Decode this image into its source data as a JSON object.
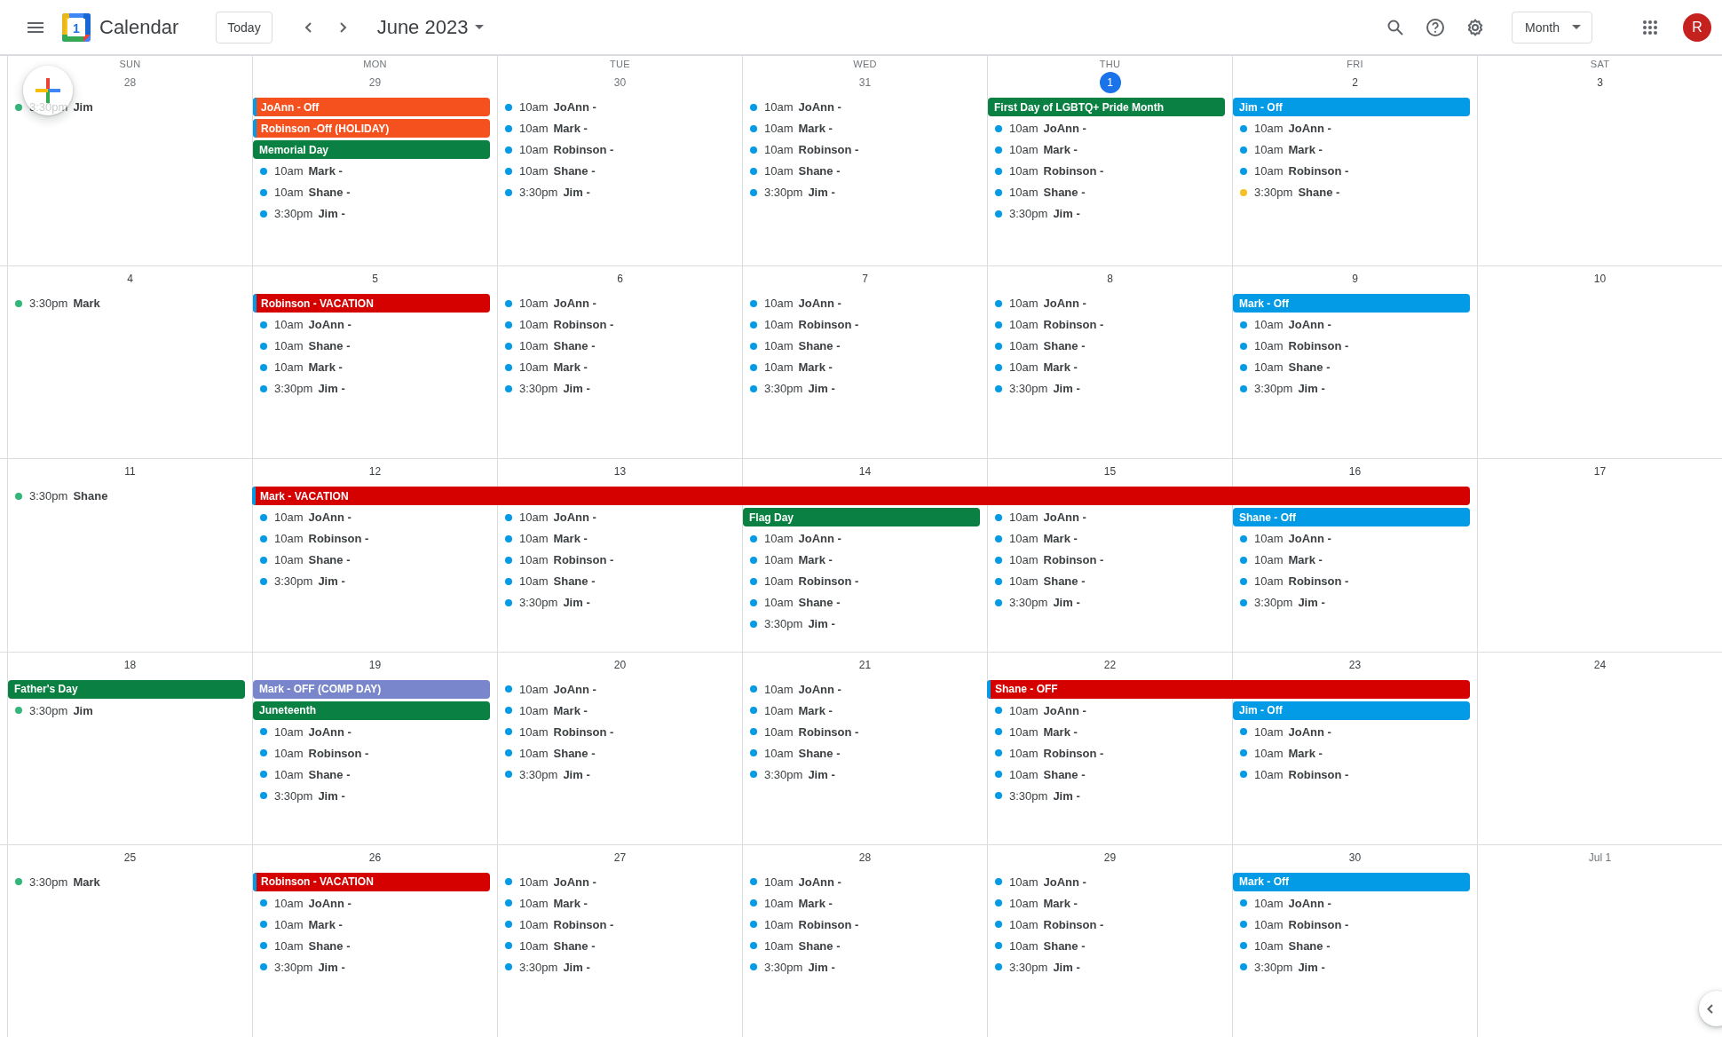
{
  "header": {
    "logo_day": "1",
    "app_name": "Calendar",
    "today_button": "Today",
    "period": "June 2023",
    "view_menu": "Month",
    "avatar_letter": "R"
  },
  "weeks": [
    {
      "days": [
        {
          "weekday": "SUN",
          "date": "28",
          "in_month": false,
          "today": false,
          "events": [
            {
              "kind": "timed",
              "time": "3:30pm",
              "title": "Jim",
              "color": "#33b679"
            }
          ]
        },
        {
          "weekday": "MON",
          "date": "29",
          "in_month": false,
          "today": false,
          "events": [
            {
              "kind": "allday",
              "title": "JoAnn - Off",
              "color": "#f4511e",
              "calendar_stripe": true
            },
            {
              "kind": "allday",
              "title": "Robinson -Off (HOLIDAY)",
              "color": "#f4511e",
              "calendar_stripe": true
            },
            {
              "kind": "allday",
              "title": "Memorial Day",
              "color": "#0b8043"
            },
            {
              "kind": "timed",
              "time": "10am",
              "title": "Mark -",
              "color": "#039be5"
            },
            {
              "kind": "timed",
              "time": "10am",
              "title": "Shane -",
              "color": "#039be5"
            },
            {
              "kind": "timed",
              "time": "3:30pm",
              "title": "Jim -",
              "color": "#039be5"
            }
          ]
        },
        {
          "weekday": "TUE",
          "date": "30",
          "in_month": false,
          "today": false,
          "events": [
            {
              "kind": "timed",
              "time": "10am",
              "title": "JoAnn -",
              "color": "#039be5"
            },
            {
              "kind": "timed",
              "time": "10am",
              "title": "Mark -",
              "color": "#039be5"
            },
            {
              "kind": "timed",
              "time": "10am",
              "title": "Robinson -",
              "color": "#039be5"
            },
            {
              "kind": "timed",
              "time": "10am",
              "title": "Shane -",
              "color": "#039be5"
            },
            {
              "kind": "timed",
              "time": "3:30pm",
              "title": "Jim -",
              "color": "#039be5"
            }
          ]
        },
        {
          "weekday": "WED",
          "date": "31",
          "in_month": false,
          "today": false,
          "events": [
            {
              "kind": "timed",
              "time": "10am",
              "title": "JoAnn -",
              "color": "#039be5"
            },
            {
              "kind": "timed",
              "time": "10am",
              "title": "Mark -",
              "color": "#039be5"
            },
            {
              "kind": "timed",
              "time": "10am",
              "title": "Robinson -",
              "color": "#039be5"
            },
            {
              "kind": "timed",
              "time": "10am",
              "title": "Shane -",
              "color": "#039be5"
            },
            {
              "kind": "timed",
              "time": "3:30pm",
              "title": "Jim -",
              "color": "#039be5"
            }
          ]
        },
        {
          "weekday": "THU",
          "date": "1",
          "in_month": true,
          "today": true,
          "events": [
            {
              "kind": "allday",
              "title": "First Day of LGBTQ+ Pride Month",
              "color": "#0b8043"
            },
            {
              "kind": "timed",
              "time": "10am",
              "title": "JoAnn -",
              "color": "#039be5"
            },
            {
              "kind": "timed",
              "time": "10am",
              "title": "Mark -",
              "color": "#039be5"
            },
            {
              "kind": "timed",
              "time": "10am",
              "title": "Robinson -",
              "color": "#039be5"
            },
            {
              "kind": "timed",
              "time": "10am",
              "title": "Shane -",
              "color": "#039be5"
            },
            {
              "kind": "timed",
              "time": "3:30pm",
              "title": "Jim -",
              "color": "#039be5"
            }
          ]
        },
        {
          "weekday": "FRI",
          "date": "2",
          "in_month": true,
          "today": false,
          "events": [
            {
              "kind": "allday",
              "title": "Jim - Off",
              "color": "#039be5"
            },
            {
              "kind": "timed",
              "time": "10am",
              "title": "JoAnn -",
              "color": "#039be5"
            },
            {
              "kind": "timed",
              "time": "10am",
              "title": "Mark -",
              "color": "#039be5"
            },
            {
              "kind": "timed",
              "time": "10am",
              "title": "Robinson -",
              "color": "#039be5"
            },
            {
              "kind": "timed",
              "time": "3:30pm",
              "title": "Shane -",
              "color": "#f6bf26"
            }
          ]
        },
        {
          "weekday": "SAT",
          "date": "3",
          "in_month": true,
          "today": false
        }
      ]
    },
    {
      "days": [
        {
          "date": "4",
          "in_month": true,
          "today": false,
          "events": [
            {
              "kind": "timed",
              "time": "3:30pm",
              "title": "Mark",
              "color": "#33b679"
            }
          ]
        },
        {
          "date": "5",
          "in_month": true,
          "today": false,
          "events": [
            {
              "kind": "allday",
              "title": "Robinson - VACATION",
              "color": "#d50000",
              "calendar_stripe": true
            },
            {
              "kind": "timed",
              "time": "10am",
              "title": "JoAnn -",
              "color": "#039be5"
            },
            {
              "kind": "timed",
              "time": "10am",
              "title": "Shane -",
              "color": "#039be5"
            },
            {
              "kind": "timed",
              "time": "10am",
              "title": "Mark -",
              "color": "#039be5"
            },
            {
              "kind": "timed",
              "time": "3:30pm",
              "title": "Jim -",
              "color": "#039be5"
            }
          ]
        },
        {
          "date": "6",
          "in_month": true,
          "today": false,
          "events": [
            {
              "kind": "timed",
              "time": "10am",
              "title": "JoAnn -",
              "color": "#039be5"
            },
            {
              "kind": "timed",
              "time": "10am",
              "title": "Robinson -",
              "color": "#039be5"
            },
            {
              "kind": "timed",
              "time": "10am",
              "title": "Shane -",
              "color": "#039be5"
            },
            {
              "kind": "timed",
              "time": "10am",
              "title": "Mark -",
              "color": "#039be5"
            },
            {
              "kind": "timed",
              "time": "3:30pm",
              "title": "Jim -",
              "color": "#039be5"
            }
          ]
        },
        {
          "date": "7",
          "in_month": true,
          "today": false,
          "events": [
            {
              "kind": "timed",
              "time": "10am",
              "title": "JoAnn -",
              "color": "#039be5"
            },
            {
              "kind": "timed",
              "time": "10am",
              "title": "Robinson -",
              "color": "#039be5"
            },
            {
              "kind": "timed",
              "time": "10am",
              "title": "Shane -",
              "color": "#039be5"
            },
            {
              "kind": "timed",
              "time": "10am",
              "title": "Mark -",
              "color": "#039be5"
            },
            {
              "kind": "timed",
              "time": "3:30pm",
              "title": "Jim -",
              "color": "#039be5"
            }
          ]
        },
        {
          "date": "8",
          "in_month": true,
          "today": false,
          "events": [
            {
              "kind": "timed",
              "time": "10am",
              "title": "JoAnn -",
              "color": "#039be5"
            },
            {
              "kind": "timed",
              "time": "10am",
              "title": "Robinson -",
              "color": "#039be5"
            },
            {
              "kind": "timed",
              "time": "10am",
              "title": "Shane -",
              "color": "#039be5"
            },
            {
              "kind": "timed",
              "time": "10am",
              "title": "Mark -",
              "color": "#039be5"
            },
            {
              "kind": "timed",
              "time": "3:30pm",
              "title": "Jim -",
              "color": "#039be5"
            }
          ]
        },
        {
          "date": "9",
          "in_month": true,
          "today": false,
          "events": [
            {
              "kind": "allday",
              "title": "Mark - Off",
              "color": "#039be5"
            },
            {
              "kind": "timed",
              "time": "10am",
              "title": "JoAnn -",
              "color": "#039be5"
            },
            {
              "kind": "timed",
              "time": "10am",
              "title": "Robinson -",
              "color": "#039be5"
            },
            {
              "kind": "timed",
              "time": "10am",
              "title": "Shane -",
              "color": "#039be5"
            },
            {
              "kind": "timed",
              "time": "3:30pm",
              "title": "Jim -",
              "color": "#039be5"
            }
          ]
        },
        {
          "date": "10",
          "in_month": true,
          "today": false
        }
      ]
    },
    {
      "banners": [
        {
          "title": "Mark - VACATION",
          "color": "#d50000",
          "calendar_stripe": true,
          "covers": [
            false,
            true,
            true,
            true,
            true,
            true,
            false
          ]
        }
      ],
      "days": [
        {
          "date": "11",
          "in_month": true,
          "today": false,
          "events": [
            {
              "kind": "timed",
              "time": "3:30pm",
              "title": "Shane",
              "color": "#33b679"
            }
          ]
        },
        {
          "date": "12",
          "in_month": true,
          "today": false,
          "events": [
            {
              "kind": "timed",
              "time": "10am",
              "title": "JoAnn -",
              "color": "#039be5"
            },
            {
              "kind": "timed",
              "time": "10am",
              "title": "Robinson -",
              "color": "#039be5"
            },
            {
              "kind": "timed",
              "time": "10am",
              "title": "Shane -",
              "color": "#039be5"
            },
            {
              "kind": "timed",
              "time": "3:30pm",
              "title": "Jim -",
              "color": "#039be5"
            }
          ]
        },
        {
          "date": "13",
          "in_month": true,
          "today": false,
          "events": [
            {
              "kind": "timed",
              "time": "10am",
              "title": "JoAnn -",
              "color": "#039be5"
            },
            {
              "kind": "timed",
              "time": "10am",
              "title": "Mark -",
              "color": "#039be5"
            },
            {
              "kind": "timed",
              "time": "10am",
              "title": "Robinson -",
              "color": "#039be5"
            },
            {
              "kind": "timed",
              "time": "10am",
              "title": "Shane -",
              "color": "#039be5"
            },
            {
              "kind": "timed",
              "time": "3:30pm",
              "title": "Jim -",
              "color": "#039be5"
            }
          ]
        },
        {
          "date": "14",
          "in_month": true,
          "today": false,
          "events": [
            {
              "kind": "allday",
              "title": "Flag Day",
              "color": "#0b8043"
            },
            {
              "kind": "timed",
              "time": "10am",
              "title": "JoAnn -",
              "color": "#039be5"
            },
            {
              "kind": "timed",
              "time": "10am",
              "title": "Mark -",
              "color": "#039be5"
            },
            {
              "kind": "timed",
              "time": "10am",
              "title": "Robinson -",
              "color": "#039be5"
            },
            {
              "kind": "timed",
              "time": "10am",
              "title": "Shane -",
              "color": "#039be5"
            },
            {
              "kind": "timed",
              "time": "3:30pm",
              "title": "Jim -",
              "color": "#039be5"
            }
          ]
        },
        {
          "date": "15",
          "in_month": true,
          "today": false,
          "events": [
            {
              "kind": "timed",
              "time": "10am",
              "title": "JoAnn -",
              "color": "#039be5"
            },
            {
              "kind": "timed",
              "time": "10am",
              "title": "Mark -",
              "color": "#039be5"
            },
            {
              "kind": "timed",
              "time": "10am",
              "title": "Robinson -",
              "color": "#039be5"
            },
            {
              "kind": "timed",
              "time": "10am",
              "title": "Shane -",
              "color": "#039be5"
            },
            {
              "kind": "timed",
              "time": "3:30pm",
              "title": "Jim -",
              "color": "#039be5"
            }
          ]
        },
        {
          "date": "16",
          "in_month": true,
          "today": false,
          "events": [
            {
              "kind": "allday",
              "title": "Shane - Off",
              "color": "#039be5"
            },
            {
              "kind": "timed",
              "time": "10am",
              "title": "JoAnn -",
              "color": "#039be5"
            },
            {
              "kind": "timed",
              "time": "10am",
              "title": "Mark -",
              "color": "#039be5"
            },
            {
              "kind": "timed",
              "time": "10am",
              "title": "Robinson -",
              "color": "#039be5"
            },
            {
              "kind": "timed",
              "time": "3:30pm",
              "title": "Jim -",
              "color": "#039be5"
            }
          ]
        },
        {
          "date": "17",
          "in_month": true,
          "today": false
        }
      ]
    },
    {
      "banners": [
        {
          "title": "Shane - OFF",
          "color": "#d50000",
          "calendar_stripe": true,
          "covers": [
            false,
            false,
            false,
            false,
            true,
            true,
            false
          ]
        }
      ],
      "days": [
        {
          "date": "18",
          "in_month": true,
          "today": false,
          "events": [
            {
              "kind": "allday",
              "title": "Father's Day",
              "color": "#0b8043"
            },
            {
              "kind": "timed",
              "time": "3:30pm",
              "title": "Jim",
              "color": "#33b679"
            }
          ]
        },
        {
          "date": "19",
          "in_month": true,
          "today": false,
          "events": [
            {
              "kind": "allday",
              "title": "Mark - OFF (COMP DAY)",
              "color": "#7986cb"
            },
            {
              "kind": "allday",
              "title": "Juneteenth",
              "color": "#0b8043"
            },
            {
              "kind": "timed",
              "time": "10am",
              "title": "JoAnn -",
              "color": "#039be5"
            },
            {
              "kind": "timed",
              "time": "10am",
              "title": "Robinson -",
              "color": "#039be5"
            },
            {
              "kind": "timed",
              "time": "10am",
              "title": "Shane -",
              "color": "#039be5"
            },
            {
              "kind": "timed",
              "time": "3:30pm",
              "title": "Jim -",
              "color": "#039be5"
            }
          ]
        },
        {
          "date": "20",
          "in_month": true,
          "today": false,
          "events": [
            {
              "kind": "timed",
              "time": "10am",
              "title": "JoAnn -",
              "color": "#039be5"
            },
            {
              "kind": "timed",
              "time": "10am",
              "title": "Mark -",
              "color": "#039be5"
            },
            {
              "kind": "timed",
              "time": "10am",
              "title": "Robinson -",
              "color": "#039be5"
            },
            {
              "kind": "timed",
              "time": "10am",
              "title": "Shane -",
              "color": "#039be5"
            },
            {
              "kind": "timed",
              "time": "3:30pm",
              "title": "Jim -",
              "color": "#039be5"
            }
          ]
        },
        {
          "date": "21",
          "in_month": true,
          "today": false,
          "events": [
            {
              "kind": "timed",
              "time": "10am",
              "title": "JoAnn -",
              "color": "#039be5"
            },
            {
              "kind": "timed",
              "time": "10am",
              "title": "Mark -",
              "color": "#039be5"
            },
            {
              "kind": "timed",
              "time": "10am",
              "title": "Robinson -",
              "color": "#039be5"
            },
            {
              "kind": "timed",
              "time": "10am",
              "title": "Shane -",
              "color": "#039be5"
            },
            {
              "kind": "timed",
              "time": "3:30pm",
              "title": "Jim -",
              "color": "#039be5"
            }
          ]
        },
        {
          "date": "22",
          "in_month": true,
          "today": false,
          "events": [
            {
              "kind": "timed",
              "time": "10am",
              "title": "JoAnn -",
              "color": "#039be5"
            },
            {
              "kind": "timed",
              "time": "10am",
              "title": "Mark -",
              "color": "#039be5"
            },
            {
              "kind": "timed",
              "time": "10am",
              "title": "Robinson -",
              "color": "#039be5"
            },
            {
              "kind": "timed",
              "time": "10am",
              "title": "Shane -",
              "color": "#039be5"
            },
            {
              "kind": "timed",
              "time": "3:30pm",
              "title": "Jim -",
              "color": "#039be5"
            }
          ]
        },
        {
          "date": "23",
          "in_month": true,
          "today": false,
          "events": [
            {
              "kind": "allday",
              "title": "Jim - Off",
              "color": "#039be5"
            },
            {
              "kind": "timed",
              "time": "10am",
              "title": "JoAnn -",
              "color": "#039be5"
            },
            {
              "kind": "timed",
              "time": "10am",
              "title": "Mark -",
              "color": "#039be5"
            },
            {
              "kind": "timed",
              "time": "10am",
              "title": "Robinson -",
              "color": "#039be5"
            }
          ]
        },
        {
          "date": "24",
          "in_month": true,
          "today": false
        }
      ]
    },
    {
      "days": [
        {
          "date": "25",
          "in_month": true,
          "today": false,
          "events": [
            {
              "kind": "timed",
              "time": "3:30pm",
              "title": "Mark",
              "color": "#33b679"
            }
          ]
        },
        {
          "date": "26",
          "in_month": true,
          "today": false,
          "events": [
            {
              "kind": "allday",
              "title": "Robinson - VACATION",
              "color": "#d50000",
              "calendar_stripe": true
            },
            {
              "kind": "timed",
              "time": "10am",
              "title": "JoAnn -",
              "color": "#039be5"
            },
            {
              "kind": "timed",
              "time": "10am",
              "title": "Mark -",
              "color": "#039be5"
            },
            {
              "kind": "timed",
              "time": "10am",
              "title": "Shane -",
              "color": "#039be5"
            },
            {
              "kind": "timed",
              "time": "3:30pm",
              "title": "Jim -",
              "color": "#039be5"
            }
          ]
        },
        {
          "date": "27",
          "in_month": true,
          "today": false,
          "events": [
            {
              "kind": "timed",
              "time": "10am",
              "title": "JoAnn -",
              "color": "#039be5"
            },
            {
              "kind": "timed",
              "time": "10am",
              "title": "Mark -",
              "color": "#039be5"
            },
            {
              "kind": "timed",
              "time": "10am",
              "title": "Robinson -",
              "color": "#039be5"
            },
            {
              "kind": "timed",
              "time": "10am",
              "title": "Shane -",
              "color": "#039be5"
            },
            {
              "kind": "timed",
              "time": "3:30pm",
              "title": "Jim -",
              "color": "#039be5"
            }
          ]
        },
        {
          "date": "28",
          "in_month": true,
          "today": false,
          "events": [
            {
              "kind": "timed",
              "time": "10am",
              "title": "JoAnn -",
              "color": "#039be5"
            },
            {
              "kind": "timed",
              "time": "10am",
              "title": "Mark -",
              "color": "#039be5"
            },
            {
              "kind": "timed",
              "time": "10am",
              "title": "Robinson -",
              "color": "#039be5"
            },
            {
              "kind": "timed",
              "time": "10am",
              "title": "Shane -",
              "color": "#039be5"
            },
            {
              "kind": "timed",
              "time": "3:30pm",
              "title": "Jim -",
              "color": "#039be5"
            }
          ]
        },
        {
          "date": "29",
          "in_month": true,
          "today": false,
          "events": [
            {
              "kind": "timed",
              "time": "10am",
              "title": "JoAnn -",
              "color": "#039be5"
            },
            {
              "kind": "timed",
              "time": "10am",
              "title": "Mark -",
              "color": "#039be5"
            },
            {
              "kind": "timed",
              "time": "10am",
              "title": "Robinson -",
              "color": "#039be5"
            },
            {
              "kind": "timed",
              "time": "10am",
              "title": "Shane -",
              "color": "#039be5"
            },
            {
              "kind": "timed",
              "time": "3:30pm",
              "title": "Jim -",
              "color": "#039be5"
            }
          ]
        },
        {
          "date": "30",
          "in_month": true,
          "today": false,
          "events": [
            {
              "kind": "allday",
              "title": "Mark - Off",
              "color": "#039be5"
            },
            {
              "kind": "timed",
              "time": "10am",
              "title": "JoAnn -",
              "color": "#039be5"
            },
            {
              "kind": "timed",
              "time": "10am",
              "title": "Robinson -",
              "color": "#039be5"
            },
            {
              "kind": "timed",
              "time": "10am",
              "title": "Shane -",
              "color": "#039be5"
            },
            {
              "kind": "timed",
              "time": "3:30pm",
              "title": "Jim -",
              "color": "#039be5"
            }
          ]
        },
        {
          "date": "Jul 1",
          "in_month": false,
          "today": false
        }
      ]
    }
  ]
}
